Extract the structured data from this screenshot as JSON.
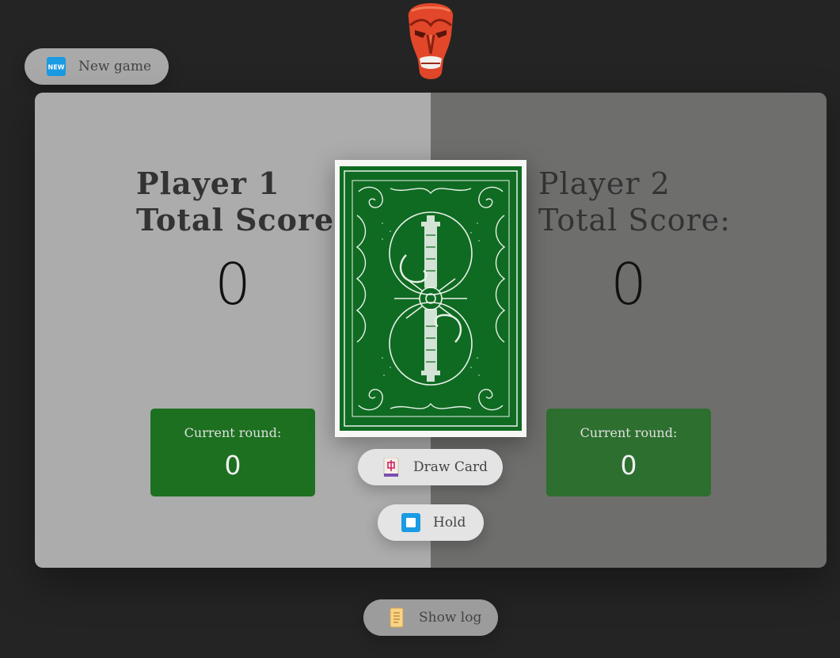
{
  "header": {
    "mask_icon": "red-mask-icon"
  },
  "buttons": {
    "new_game": {
      "label": "New game",
      "icon": "new-badge-icon"
    },
    "draw_card": {
      "label": "Draw Card",
      "icon": "mahjong-tile-icon"
    },
    "hold": {
      "label": "Hold",
      "icon": "stop-square-icon"
    },
    "show_log": {
      "label": "Show log",
      "icon": "scroll-icon"
    }
  },
  "players": [
    {
      "name": "Player 1",
      "total_label": "Total Score:",
      "score": "0",
      "current_round_label": "Current round:",
      "current_round": "0",
      "active": true
    },
    {
      "name": "Player 2",
      "total_label": "Total Score:",
      "score": "0",
      "current_round_label": "Current round:",
      "current_round": "0",
      "active": false
    }
  ],
  "card": {
    "face": "back",
    "icon": "card-back-icon"
  },
  "colors": {
    "background": "#232423",
    "player1_panel": "#acacac",
    "player2_panel": "#6e6f6d",
    "round_box_active": "#1c7020",
    "round_box_inactive": "#2d6f2f",
    "card_green": "#0f6b22"
  }
}
